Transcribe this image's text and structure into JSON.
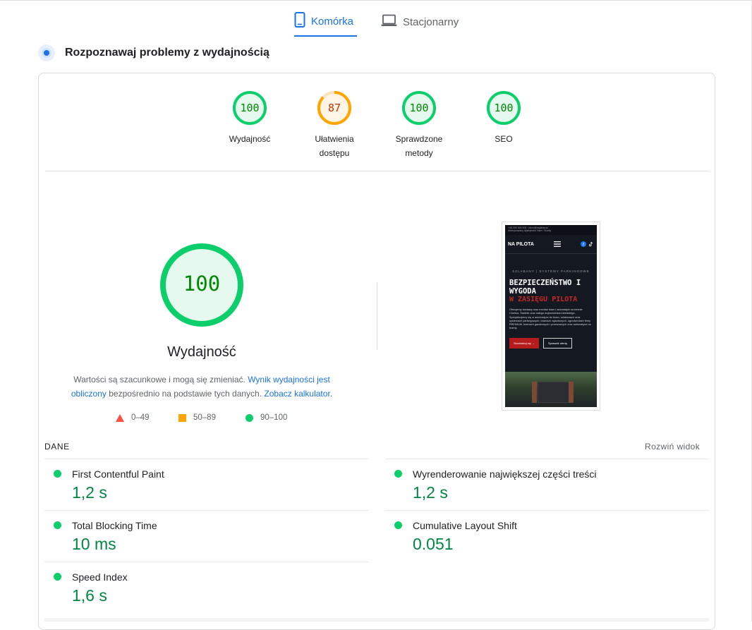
{
  "tabs": [
    {
      "label": "Komórka",
      "icon": "smartphone-icon",
      "active": true
    },
    {
      "label": "Stacjonarny",
      "icon": "laptop-icon",
      "active": false
    }
  ],
  "section": {
    "title": "Rozpoznawaj problemy z wydajnością",
    "icon": "diagnose-icon"
  },
  "scores": [
    {
      "value": "100",
      "label": "Wydajność",
      "color": "#0cce6b",
      "fraction": 1.0
    },
    {
      "value": "87",
      "label": "Ułatwienia dostępu",
      "color": "#ffa400",
      "fraction": 0.87
    },
    {
      "value": "100",
      "label": "Sprawdzone metody",
      "color": "#0cce6b",
      "fraction": 1.0
    },
    {
      "value": "100",
      "label": "SEO",
      "color": "#0cce6b",
      "fraction": 1.0
    }
  ],
  "performance": {
    "score": "100",
    "title": "Wydajność",
    "note_1": "Wartości są szacunkowe i mogą się zmieniać. ",
    "note_link_1": "Wynik wydajności jest obliczony",
    "note_2": " bezpośrednio na podstawie tych danych. ",
    "note_link_2": "Zobacz kalkulator."
  },
  "legend": [
    {
      "range": "0–49",
      "shape": "triangle",
      "color": "#ff4e42"
    },
    {
      "range": "50–89",
      "shape": "square",
      "color": "#ffa400"
    },
    {
      "range": "90–100",
      "shape": "circle",
      "color": "#0cce6b"
    }
  ],
  "screenshot": {
    "top_bar": "+48 000 000 000   ·   biuro@napilota.pl",
    "top_bar_2": "Autoryzowany dystrybutor Nice / Somfy",
    "logo": "NA PILOTA",
    "kicker": "SZLABANY | SYSTEMY PARKINGOWE",
    "headline_1": "BEZPIECZEŃSTWO I",
    "headline_2": "WYGODA",
    "headline_3": "W ZASIĘGU PILOTA",
    "paragraph": "Oferujemy dostawę oraz montaż bram i automatyki na terenie Chełma, Świdnik oraz całego województwa lubelskiego. Specjalizujemy się w automatyce do bram, szlabanach oraz systemach parkingowych, bramach wjazdowych, ogrodzeniach firmy PREMIUM, bramach garażowych i przesuwnych oraz automatyce na bramy.",
    "button_primary": "Skontaktuj się →",
    "button_secondary": "Sprawdź ofertę"
  },
  "metrics": {
    "heading": "DANE",
    "expand": "Rozwiń widok",
    "items": [
      {
        "name": "First Contentful Paint",
        "value": "1,2 s"
      },
      {
        "name": "Wyrenderowanie największej części treści",
        "value": "1,2 s"
      },
      {
        "name": "Total Blocking Time",
        "value": "10 ms"
      },
      {
        "name": "Cumulative Layout Shift",
        "value": "0.051"
      },
      {
        "name": "Speed Index",
        "value": "1,6 s"
      }
    ]
  }
}
